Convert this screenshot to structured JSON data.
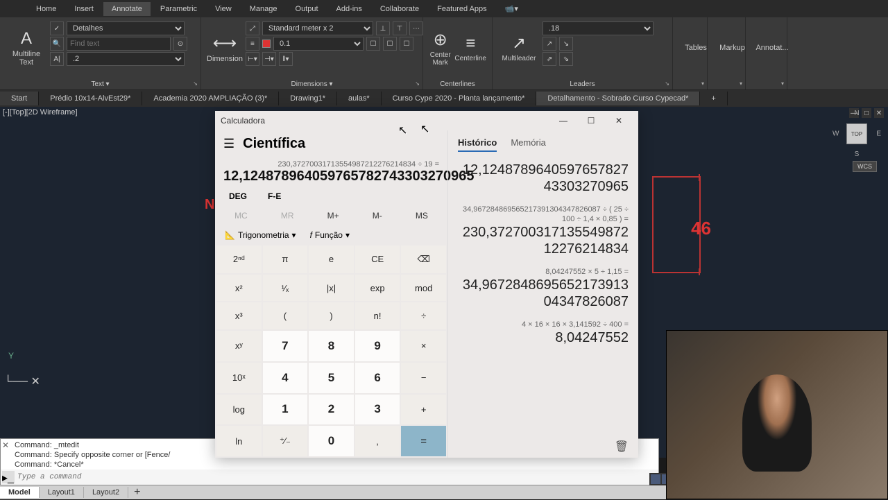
{
  "ribbon": {
    "tabs": [
      "Home",
      "Insert",
      "Annotate",
      "Parametric",
      "View",
      "Manage",
      "Output",
      "Add-ins",
      "Collaborate",
      "Featured Apps"
    ],
    "active_tab": "Annotate",
    "text": {
      "label": "Multiline\nText",
      "style": "Detalhes",
      "find_placeholder": "Find text",
      "height": ".2",
      "group": "Text"
    },
    "dim": {
      "label": "Dimension",
      "style": "Standard meter x 2",
      "layer_val": "0.1",
      "group": "Dimensions"
    },
    "center": {
      "mark": "Center\nMark",
      "line": "Centerline",
      "group": "Centerlines"
    },
    "leaders": {
      "label": "Multileader",
      "style": ".18",
      "group": "Leaders"
    },
    "extra": [
      "Tables",
      "Markup",
      "Annotat..."
    ]
  },
  "doc_tabs": [
    "Start",
    "Prédio 10x14-AlvEst29*",
    "Academia 2020 AMPLIAÇÃO (3)*",
    "Drawing1*",
    "aulas*",
    "Curso Cype 2020 - Planta lançamento*",
    "Detalhamento - Sobrado Curso Cypecad*"
  ],
  "viewport": {
    "label": "[-][Top][2D Wireframe]",
    "n": "N",
    "num": "46"
  },
  "viewcube": {
    "n": "N",
    "s": "S",
    "e": "E",
    "w": "W",
    "top": "TOP",
    "wcs": "WCS"
  },
  "cmdline": {
    "lines": [
      "Command: _mtedit",
      "Command: Specify opposite corner or [Fence/",
      "Command: *Cancel*"
    ],
    "placeholder": "Type a command"
  },
  "layout_tabs": {
    "tabs": [
      "Model",
      "Layout1",
      "Layout2"
    ],
    "active": "Model"
  },
  "calc": {
    "title": "Calculadora",
    "mode": "Científica",
    "expr": "230,37270031713554987212276214834 ÷ 19 =",
    "result": "12,124878964059765782743303270965",
    "deg": "DEG",
    "fe": "F-E",
    "mem": {
      "mc": "MC",
      "mr": "MR",
      "mp": "M+",
      "mm": "M-",
      "ms": "MS"
    },
    "trig": "Trigonometria",
    "func": "Função",
    "btns": {
      "r0": [
        "2ⁿᵈ",
        "π",
        "e",
        "CE",
        "⌫"
      ],
      "r1": [
        "x²",
        "¹⁄ₓ",
        "|x|",
        "exp",
        "mod"
      ],
      "r2": [
        "x³",
        "(",
        ")",
        "n!",
        "÷"
      ],
      "r3": [
        "xʸ",
        "7",
        "8",
        "9",
        "×"
      ],
      "r4": [
        "10ˣ",
        "4",
        "5",
        "6",
        "−"
      ],
      "r5": [
        "log",
        "1",
        "2",
        "3",
        "+"
      ],
      "r6": [
        "ln",
        "⁺⁄₋",
        "0",
        ",",
        "="
      ]
    },
    "tabs": {
      "hist": "Histórico",
      "mem": "Memória"
    },
    "history": [
      {
        "expr": "",
        "val": "12,124878964059765782743303270965"
      },
      {
        "expr": "34,967284869565217391304347826087 ÷ ( 25 ÷ 100 ÷ 1,4 × 0,85 ) =",
        "val": "230,37270031713554987212276214834"
      },
      {
        "expr": "8,04247552 × 5 ÷ 1,15 =",
        "val": "34,967284869565217391304347826087"
      },
      {
        "expr": "4 × 16 × 16 × 3,141592 ÷ 400 =",
        "val": "8,04247552"
      }
    ]
  }
}
